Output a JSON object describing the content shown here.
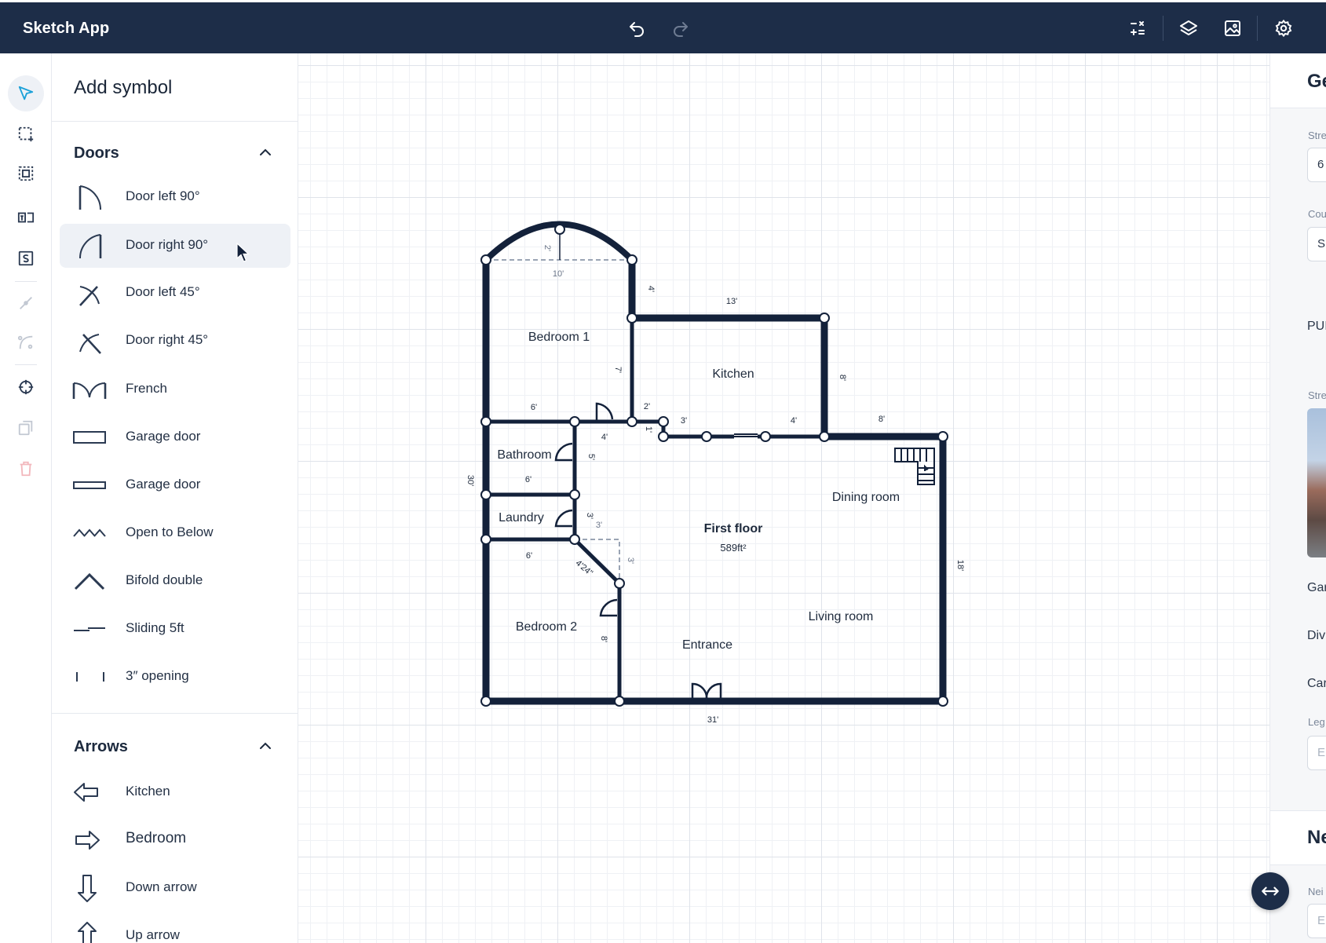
{
  "app": {
    "title": "Sketch App"
  },
  "toolbar": {
    "undo_icon": "undo-icon",
    "redo_icon": "redo-icon",
    "buttons": [
      "calculator-icon",
      "layers-icon",
      "image-icon",
      "settings-icon"
    ]
  },
  "tools": [
    "select-pointer-icon",
    "area-select-icon",
    "room-select-icon",
    "dimension-tool-icon",
    "symbol-tool-icon",
    "line-tool-icon",
    "curve-tool-icon",
    "target-icon",
    "duplicate-icon",
    "delete-icon"
  ],
  "panel": {
    "title": "Add symbol",
    "doors": {
      "title": "Doors",
      "items": [
        {
          "label": "Door left 90°",
          "icon": "door-left-90-icon"
        },
        {
          "label": "Door right 90°",
          "icon": "door-right-90-icon"
        },
        {
          "label": "Door left 45°",
          "icon": "door-left-45-icon"
        },
        {
          "label": "Door right 45°",
          "icon": "door-right-45-icon"
        },
        {
          "label": "French",
          "icon": "french-door-icon"
        },
        {
          "label": "Garage door",
          "icon": "garage-door-icon"
        },
        {
          "label": "Garage door",
          "icon": "garage-door-thin-icon"
        },
        {
          "label": "Open to Below",
          "icon": "open-to-below-icon"
        },
        {
          "label": "Bifold double",
          "icon": "bifold-double-icon"
        },
        {
          "label": "Sliding 5ft",
          "icon": "sliding-door-icon"
        },
        {
          "label": "3″ opening",
          "icon": "opening-icon"
        }
      ]
    },
    "arrows": {
      "title": "Arrows",
      "items": [
        {
          "label": "Kitchen",
          "icon": "arrow-left-icon"
        },
        {
          "label": "Bedroom",
          "icon": "arrow-right-icon"
        },
        {
          "label": "Down arrow",
          "icon": "arrow-down-icon"
        },
        {
          "label": "Up arrow",
          "icon": "arrow-up-icon"
        }
      ]
    }
  },
  "plan": {
    "rooms": {
      "bedroom1": "Bedroom 1",
      "kitchen": "Kitchen",
      "bathroom": "Bathroom",
      "laundry": "Laundry",
      "dining": "Dining room",
      "living": "Living room",
      "bedroom2": "Bedroom 2",
      "entrance": "Entrance"
    },
    "floor": {
      "name": "First floor",
      "area": "589ft²"
    },
    "dims": {
      "arch_height": "2'",
      "arch_width": "10'",
      "b1_right_upper": "4'",
      "kitchen_top": "13'",
      "kitchen_right": "8'",
      "b1_right_lower": "7'",
      "b1_bottom": "6'",
      "small_top": "2'",
      "small_side": "1'",
      "kitchen_bottom_left": "3'",
      "kitchen_bottom_right": "4'",
      "dining_top": "8'",
      "hall": "4'",
      "bath_right": "5'",
      "bath_bottom": "6'",
      "left_wall": "30'",
      "laundry_right": "3'",
      "closet_w": "3'",
      "closet_h": "3'",
      "laundry_bottom": "6'",
      "diagonal": "4'24\"",
      "b2_right": "8'",
      "right_wall": "18'",
      "bottom_wall": "31'"
    }
  },
  "right_panel": {
    "title": "Ge",
    "labels": [
      "Stre",
      "Cou",
      "PUI",
      "Stre",
      "Gar",
      "Div",
      "Car",
      "Leg",
      "Nei"
    ],
    "inputs": [
      "6",
      "S",
      "E",
      "E"
    ],
    "section2_title": "Ne"
  },
  "fab_icon": "swap-horizontal-icon"
}
